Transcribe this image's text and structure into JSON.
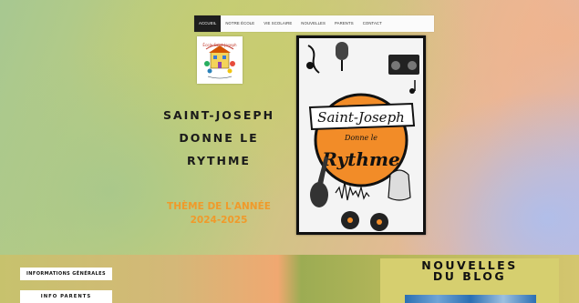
{
  "nav": {
    "items": [
      {
        "label": "ACCUEIL",
        "active": true
      },
      {
        "label": "NOTRE ÉCOLE",
        "active": false
      },
      {
        "label": "VIE SCOLAIRE",
        "active": false
      },
      {
        "label": "NOUVELLES",
        "active": false
      },
      {
        "label": "PARENTS",
        "active": false
      },
      {
        "label": "CONTACT",
        "active": false
      }
    ]
  },
  "logo": {
    "text": "École Saint-Joseph"
  },
  "hero": {
    "title_line1": "SAINT-JOSEPH",
    "title_line2": "DONNE LE",
    "title_line3": "RYTHME",
    "theme_line1": "THÈME DE L'ANNÉE",
    "theme_line2": "2024-2025"
  },
  "poster": {
    "line1": "Saint-Joseph",
    "line2": "Donne le",
    "line3": "Rythme"
  },
  "buttons": {
    "info_general": "INFORMATIONS GÉNÉRALES",
    "info_parents": "INFO PARENTS"
  },
  "blog": {
    "title_line1": "NOUVELLES",
    "title_line2": "DU BLOG"
  },
  "colors": {
    "accent_orange": "#f09a2a",
    "nav_active_bg": "#1e1e1e",
    "poster_disc": "#f28c28"
  }
}
